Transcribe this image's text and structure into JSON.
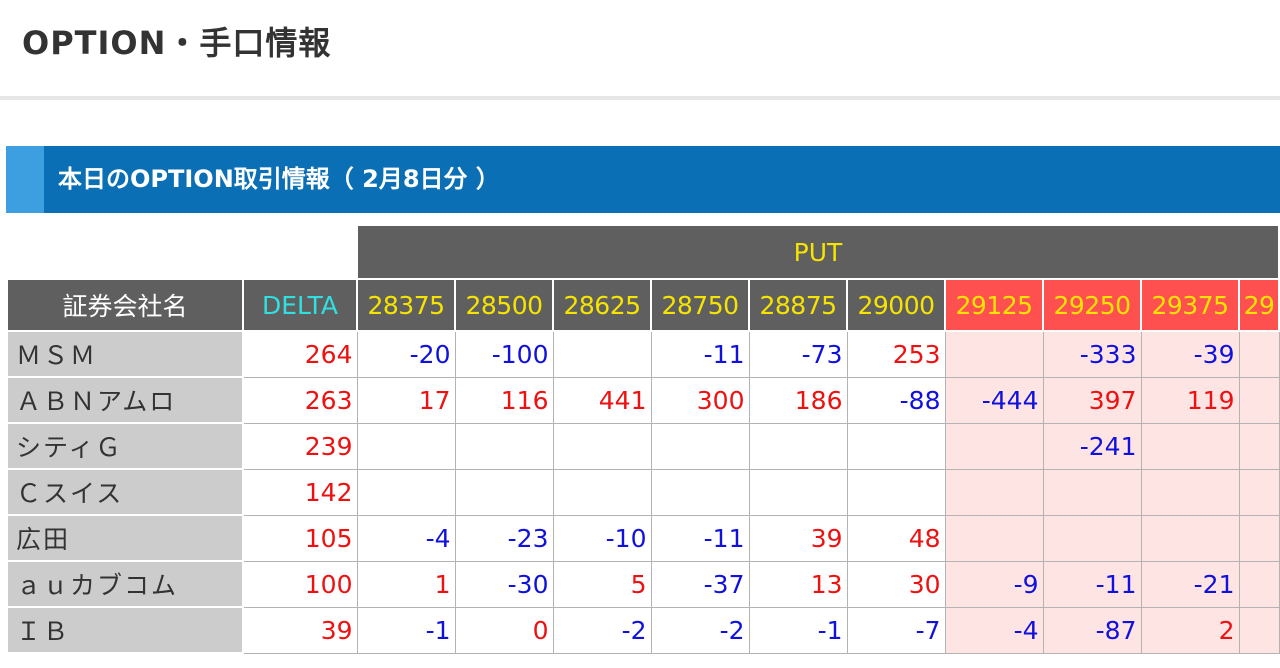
{
  "page": {
    "title": "OPTION・手口情報",
    "section_label": "本日のOPTION取引情報（ 2月8日分 ）"
  },
  "table": {
    "put_label": "PUT",
    "name_header": "証券会社名",
    "delta_header": "DELTA",
    "strikes": [
      "28375",
      "28500",
      "28625",
      "28750",
      "28875",
      "29000",
      "29125",
      "29250",
      "29375",
      "29"
    ],
    "highlight_from_index": 6,
    "colors": {
      "positive": "#ee1111",
      "negative": "#1111dd",
      "highlight_header": "#ff5050",
      "highlight_cell": "#ffe4e4"
    },
    "rows": [
      {
        "name": "ＭＳＭ",
        "delta": "264",
        "values": [
          "-20",
          "-100",
          "",
          "-11",
          "-73",
          "253",
          "",
          "-333",
          "-39",
          ""
        ]
      },
      {
        "name": "ＡＢＮアムロ",
        "delta": "263",
        "values": [
          "17",
          "116",
          "441",
          "300",
          "186",
          "-88",
          "-444",
          "397",
          "119",
          ""
        ]
      },
      {
        "name": "シティＧ",
        "delta": "239",
        "values": [
          "",
          "",
          "",
          "",
          "",
          "",
          "",
          "-241",
          "",
          ""
        ]
      },
      {
        "name": "Ｃスイス",
        "delta": "142",
        "values": [
          "",
          "",
          "",
          "",
          "",
          "",
          "",
          "",
          "",
          ""
        ]
      },
      {
        "name": "広田",
        "delta": "105",
        "values": [
          "-4",
          "-23",
          "-10",
          "-11",
          "39",
          "48",
          "",
          "",
          "",
          ""
        ]
      },
      {
        "name": "ａｕカブコム",
        "delta": "100",
        "values": [
          "1",
          "-30",
          "5",
          "-37",
          "13",
          "30",
          "-9",
          "-11",
          "-21",
          ""
        ]
      },
      {
        "name": "ＩＢ",
        "delta": "39",
        "values": [
          "-1",
          "0",
          "-2",
          "-2",
          "-1",
          "-7",
          "-4",
          "-87",
          "2",
          ""
        ]
      }
    ]
  }
}
